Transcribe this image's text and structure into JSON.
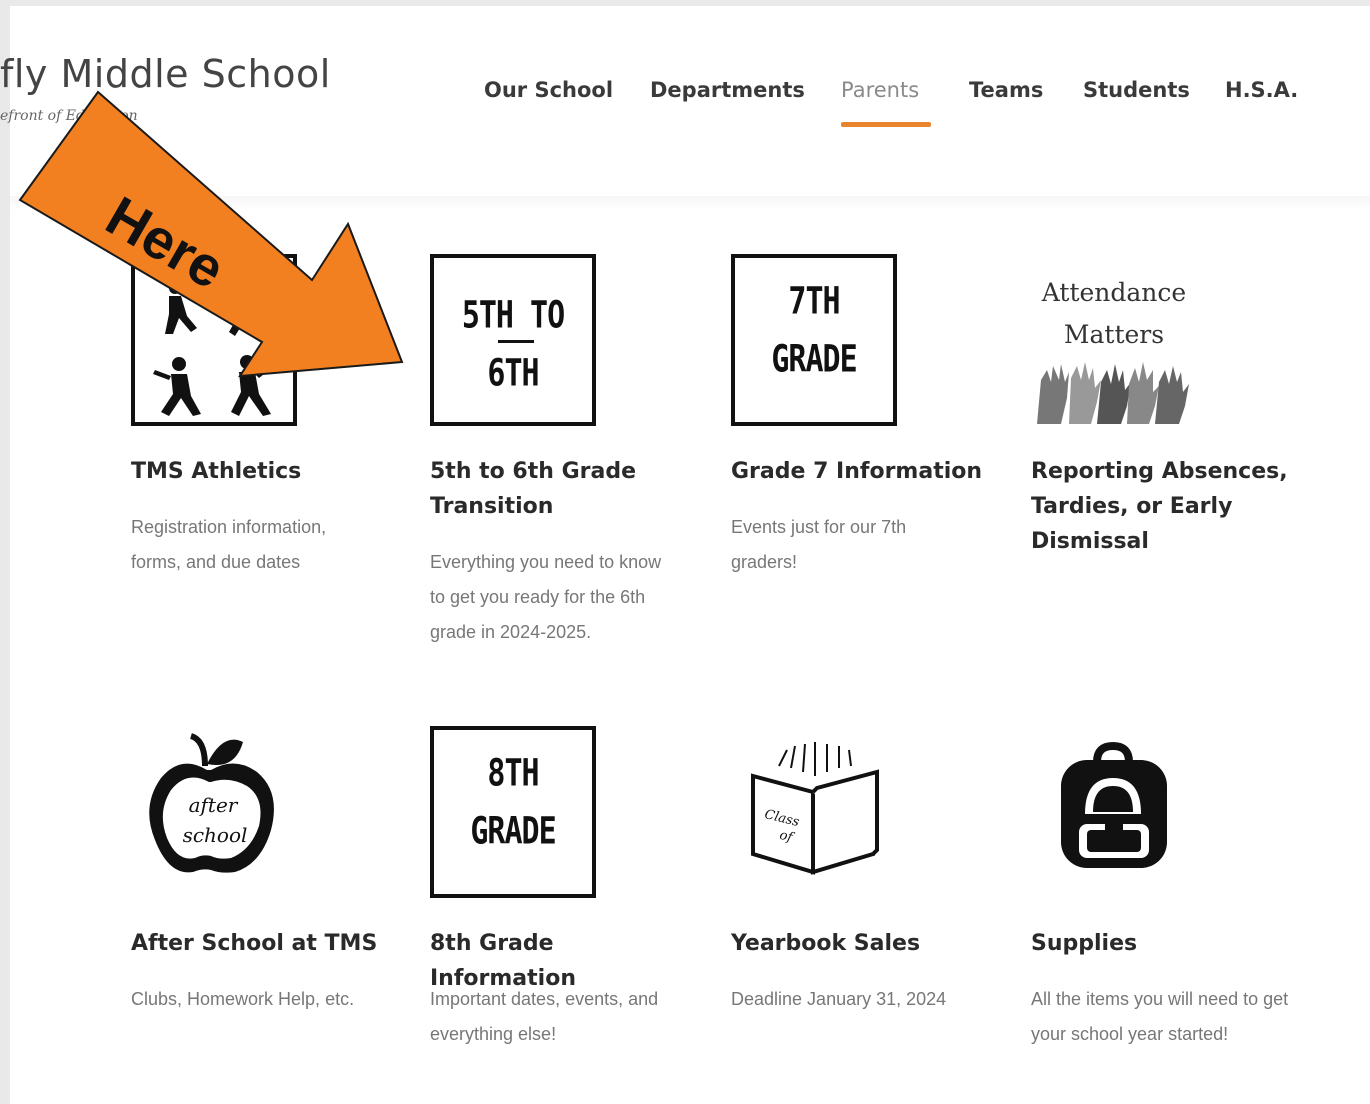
{
  "header": {
    "school_name": "fly Middle School",
    "tagline": "efront of Education"
  },
  "nav": {
    "items": [
      {
        "label": "Our School",
        "active": false
      },
      {
        "label": "Departments",
        "active": false
      },
      {
        "label": "Parents",
        "active": true
      },
      {
        "label": "Teams",
        "active": false
      },
      {
        "label": "Students",
        "active": false
      },
      {
        "label": "H.S.A.",
        "active": false
      }
    ],
    "accent_color": "#e7842c"
  },
  "annotation": {
    "label": "Here",
    "arrow_color": "#f38020"
  },
  "cards": [
    {
      "title": "TMS Athletics",
      "description": "Registration information, forms, and due dates",
      "thumbnail": {
        "icon": "athletes-silhouettes-icon"
      }
    },
    {
      "title": "5th to 6th Grade Transition",
      "description": "Everything you need to know to get you ready for the 6th grade in 2024-2025.",
      "thumbnail": {
        "line1": "5TH TO",
        "line2": "6TH"
      }
    },
    {
      "title": "Grade 7 Information",
      "description": "Events just for our 7th graders!",
      "thumbnail": {
        "line1": "7TH",
        "line2": "GRADE"
      }
    },
    {
      "title": "Reporting Absences, Tardies, or Early Dismissal",
      "description": "",
      "thumbnail": {
        "line1": "Attendance",
        "line2": "Matters",
        "icon": "raised-hands-icon"
      }
    },
    {
      "title": "After School at TMS",
      "description": "Clubs, Homework Help, etc.",
      "thumbnail": {
        "icon": "apple-icon",
        "text1": "after",
        "text2": "school"
      }
    },
    {
      "title": "8th Grade Information",
      "description": "Important dates, events, and everything else!",
      "thumbnail": {
        "line1": "8TH",
        "line2": "GRADE"
      }
    },
    {
      "title": "Yearbook Sales",
      "description": "Deadline January 31, 2024",
      "thumbnail": {
        "icon": "yearbook-icon",
        "text1": "Class",
        "text2": "of"
      }
    },
    {
      "title": "Supplies",
      "description": "All the items you will need to get your school year started!",
      "thumbnail": {
        "icon": "backpack-icon"
      }
    }
  ]
}
